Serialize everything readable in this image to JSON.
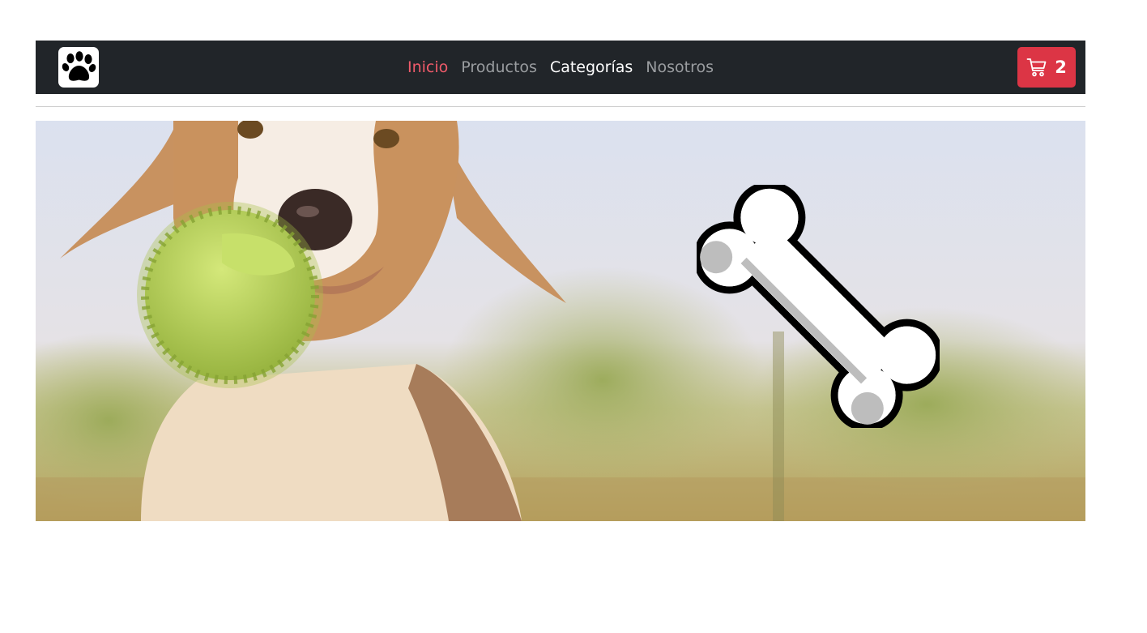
{
  "navbar": {
    "logo_icon": "paw-icon",
    "links": [
      {
        "label": "Inicio",
        "color": "#f05b6a"
      },
      {
        "label": "Productos",
        "color": "#9a9da0"
      },
      {
        "label": "Categorías",
        "color": "#ffffff"
      },
      {
        "label": "Nosotros",
        "color": "#9a9da0"
      }
    ],
    "cart": {
      "icon": "cart-icon",
      "count": "2",
      "color": "#dc3545"
    },
    "background": "#212529"
  },
  "hero": {
    "image": "dog-with-ball-photo",
    "decoration": "bone-icon"
  }
}
